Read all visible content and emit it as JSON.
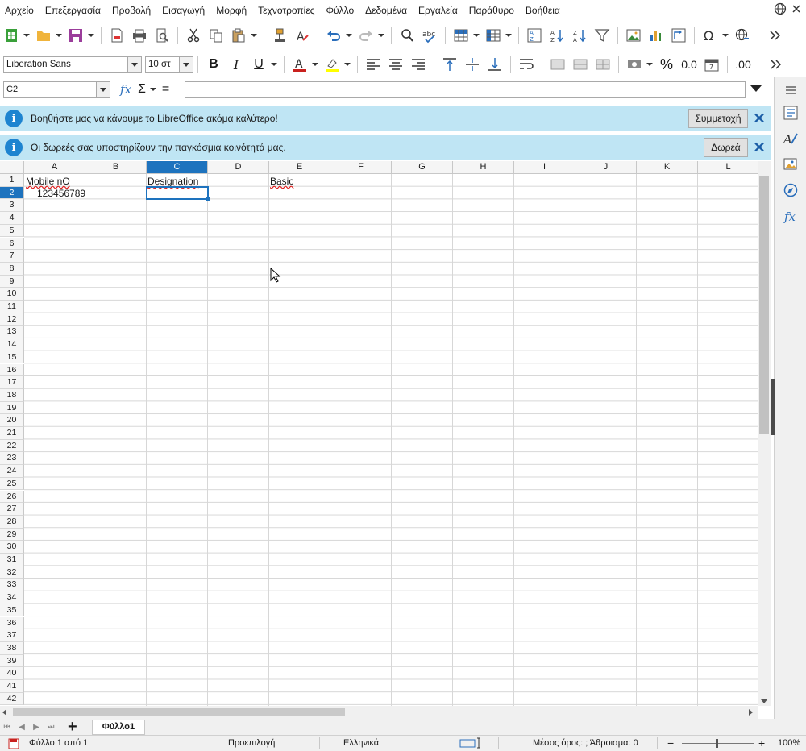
{
  "menubar": {
    "items": [
      "Αρχείο",
      "Επεξεργασία",
      "Προβολή",
      "Εισαγωγή",
      "Μορφή",
      "Τεχνοτροπίες",
      "Φύλλο",
      "Δεδομένα",
      "Εργαλεία",
      "Παράθυρο",
      "Βοήθεια"
    ]
  },
  "toolbar": {
    "font_name": "Liberation Sans",
    "font_size": "10 στ",
    "bold": "B",
    "italic": "I",
    "underline": "U",
    "percent": "%",
    "decimal": "0.0",
    "add_decimal": ".00"
  },
  "formula_bar": {
    "name_box": "C2",
    "fx": "fx",
    "sum": "Σ",
    "equals": "=",
    "formula": ""
  },
  "infobars": [
    {
      "text": "Βοηθήστε μας να κάνουμε το LibreOffice ακόμα καλύτερο!",
      "button": "Συμμετοχή",
      "close": "✕"
    },
    {
      "text": "Οι δωρεές σας υποστηρίζουν την παγκόσμια κοινότητά μας.",
      "button": "Δωρεά",
      "close": "✕"
    }
  ],
  "sheet": {
    "columns": [
      "A",
      "B",
      "C",
      "D",
      "E",
      "F",
      "G",
      "H",
      "I",
      "J",
      "K",
      "L"
    ],
    "rows": [
      "1",
      "2",
      "3",
      "4",
      "5",
      "6",
      "7",
      "8",
      "9",
      "10",
      "11",
      "12",
      "13",
      "14",
      "15",
      "16",
      "17",
      "18",
      "19",
      "20",
      "21",
      "22",
      "23",
      "24",
      "25",
      "26",
      "27",
      "28",
      "29",
      "30",
      "31",
      "32",
      "33",
      "34",
      "35",
      "36",
      "37",
      "38",
      "39",
      "40",
      "41",
      "42"
    ],
    "selected_column": "C",
    "selected_row": "2",
    "cells": {
      "A1": "Mobile nO",
      "A2": "123456789",
      "C1": "Designation",
      "E1": "Basic"
    }
  },
  "tabs": {
    "add": "+",
    "sheet_name": "Φύλλο1"
  },
  "status": {
    "sheet_info": "Φύλλο 1 από 1",
    "page_style": "Προεπιλογή",
    "language": "Ελληνικά",
    "sum_info": "Μέσος όρος: ; Άθροισμα: 0",
    "zoom": "100%"
  }
}
